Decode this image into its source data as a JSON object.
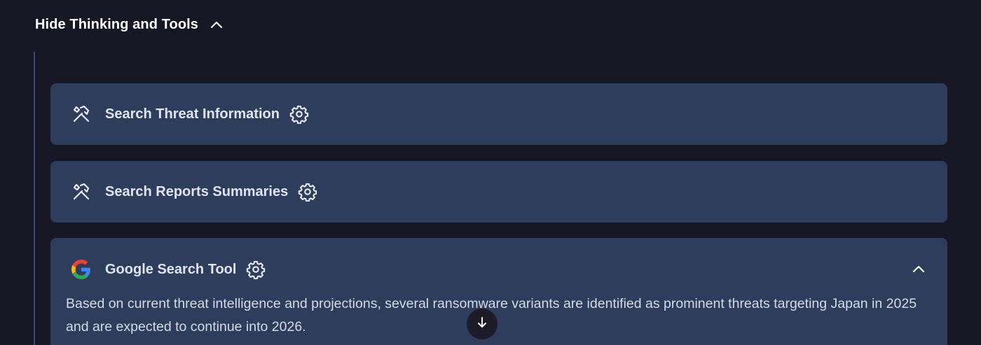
{
  "toggle": {
    "label": "Hide Thinking and Tools",
    "chevron_icon": "chevron-up-icon"
  },
  "tools": [
    {
      "title": "Search Threat Information",
      "icon": "tools-icon",
      "settings_icon": "gear-icon",
      "expanded": false
    },
    {
      "title": "Search Reports Summaries",
      "icon": "tools-icon",
      "settings_icon": "gear-icon",
      "expanded": false
    },
    {
      "title": "Google Search Tool",
      "icon": "google-logo-icon",
      "settings_icon": "gear-icon",
      "expanded": true,
      "body": "Based on current threat intelligence and projections, several ransomware variants are identified as prominent threats targeting Japan in 2025 and are expected to continue into 2026."
    }
  ],
  "scroll_button_icon": "arrow-down-icon",
  "colors": {
    "background": "#171624",
    "card": "#2f3d5c",
    "thread_line": "#3d4777"
  }
}
